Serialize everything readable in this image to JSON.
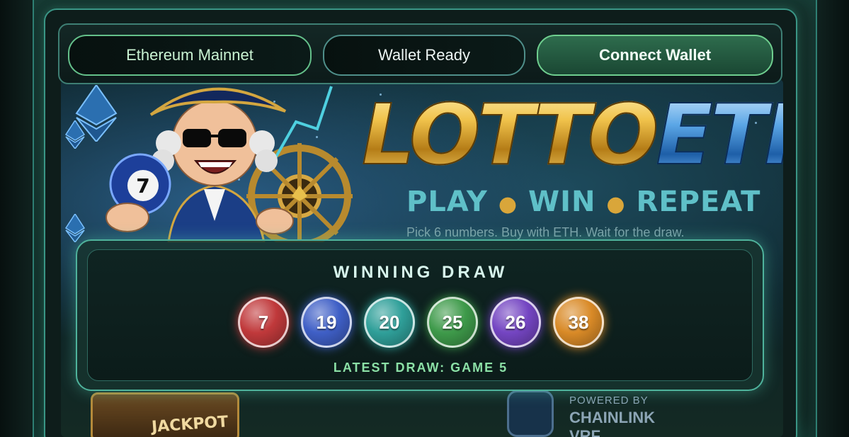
{
  "header": {
    "network_label": "Ethereum Mainnet",
    "wallet_status": "Wallet Ready",
    "connect_label": "Connect Wallet"
  },
  "hero": {
    "logo_part1": "LOTTO",
    "logo_part2": "ETH",
    "tagline": [
      "PLAY",
      "WIN",
      "REPEAT"
    ],
    "subline": "Pick 6 numbers. Buy with ETH. Wait for the draw.",
    "mascot_ball_number": "7",
    "jackpot_text": "JACKPOT",
    "powered_by_label": "POWERED BY",
    "powered_by_name": "CHAINLINK VRF"
  },
  "draw": {
    "title": "WINNING DRAW",
    "numbers": [
      {
        "value": "7",
        "color": "#c0393b"
      },
      {
        "value": "19",
        "color": "#3f5fc6"
      },
      {
        "value": "20",
        "color": "#2f9f99"
      },
      {
        "value": "25",
        "color": "#3e9a4a"
      },
      {
        "value": "26",
        "color": "#7445c2"
      },
      {
        "value": "38",
        "color": "#d98a27"
      }
    ],
    "footer": "LATEST DRAW: GAME 5"
  },
  "colors": {
    "accent_green": "#6fcf8f",
    "frame_teal": "#3a9686",
    "gold": "#f0c24b",
    "eth_blue": "#5ba6e6"
  }
}
